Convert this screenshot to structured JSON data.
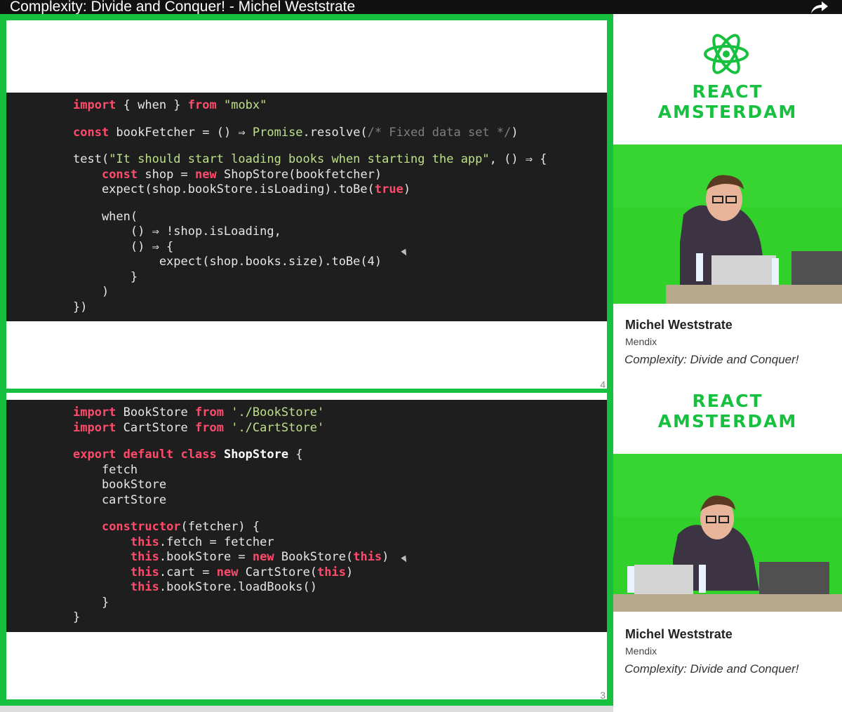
{
  "window": {
    "title": "Complexity: Divide and Conquer! - Michel Weststrate",
    "share_icon": "share-arrow-icon"
  },
  "slide1": {
    "page_number": "4",
    "code": [
      [
        [
          "kw",
          "import"
        ],
        [
          "p",
          " { when } "
        ],
        [
          "kw",
          "from"
        ],
        [
          "str",
          " \"mobx\""
        ]
      ],
      [],
      [
        [
          "kw",
          "const"
        ],
        [
          "p",
          " bookFetcher = () ⇒ "
        ],
        [
          "str",
          "Promise"
        ],
        [
          "p",
          ".resolve("
        ],
        [
          "cm",
          "/* Fixed data set */"
        ],
        [
          "p",
          ")"
        ]
      ],
      [],
      [
        [
          "p",
          "test("
        ],
        [
          "str",
          "\"It should start loading books when starting the app\""
        ],
        [
          "p",
          ", () ⇒ {"
        ]
      ],
      [
        [
          "p",
          "    "
        ],
        [
          "kw",
          "const"
        ],
        [
          "p",
          " shop = "
        ],
        [
          "kw",
          "new"
        ],
        [
          "p",
          " ShopStore(bookfetcher)"
        ]
      ],
      [
        [
          "p",
          "    expect(shop.bookStore.isLoading).toBe("
        ],
        [
          "kw",
          "true"
        ],
        [
          "p",
          ")"
        ]
      ],
      [],
      [
        [
          "p",
          "    when("
        ]
      ],
      [
        [
          "p",
          "        () ⇒ !shop.isLoading,"
        ]
      ],
      [
        [
          "p",
          "        () ⇒ {"
        ]
      ],
      [
        [
          "p",
          "            expect(shop.books.size).toBe(4)"
        ]
      ],
      [
        [
          "p",
          "        }"
        ]
      ],
      [
        [
          "p",
          "    )"
        ]
      ],
      [
        [
          "p",
          "})"
        ]
      ]
    ]
  },
  "slide2": {
    "page_number": "3",
    "code": [
      [
        [
          "kw",
          "import"
        ],
        [
          "p",
          " BookStore "
        ],
        [
          "kw",
          "from"
        ],
        [
          "str",
          " './BookStore'"
        ]
      ],
      [
        [
          "kw",
          "import"
        ],
        [
          "p",
          " CartStore "
        ],
        [
          "kw",
          "from"
        ],
        [
          "str",
          " './CartStore'"
        ]
      ],
      [],
      [
        [
          "kw",
          "export default class"
        ],
        [
          "p",
          " "
        ],
        [
          "cls",
          "ShopStore"
        ],
        [
          "p",
          " {"
        ]
      ],
      [
        [
          "p",
          "    fetch"
        ]
      ],
      [
        [
          "p",
          "    bookStore"
        ]
      ],
      [
        [
          "p",
          "    cartStore"
        ]
      ],
      [],
      [
        [
          "p",
          "    "
        ],
        [
          "kw",
          "constructor"
        ],
        [
          "p",
          "(fetcher) {"
        ]
      ],
      [
        [
          "p",
          "        "
        ],
        [
          "kw",
          "this"
        ],
        [
          "p",
          ".fetch = fetcher"
        ]
      ],
      [
        [
          "p",
          "        "
        ],
        [
          "kw",
          "this"
        ],
        [
          "p",
          ".bookStore = "
        ],
        [
          "kw",
          "new"
        ],
        [
          "p",
          " BookStore("
        ],
        [
          "kw",
          "this"
        ],
        [
          "p",
          ")"
        ]
      ],
      [
        [
          "p",
          "        "
        ],
        [
          "kw",
          "this"
        ],
        [
          "p",
          ".cart = "
        ],
        [
          "kw",
          "new"
        ],
        [
          "p",
          " CartStore("
        ],
        [
          "kw",
          "this"
        ],
        [
          "p",
          ")"
        ]
      ],
      [
        [
          "p",
          "        "
        ],
        [
          "kw",
          "this"
        ],
        [
          "p",
          ".bookStore.loadBooks()"
        ]
      ],
      [
        [
          "p",
          "    }"
        ]
      ],
      [
        [
          "p",
          "}"
        ]
      ]
    ]
  },
  "sidebar": {
    "brand_line1": "REACT",
    "brand_line2": "AMSTERDAM",
    "speaker": "Michel Weststrate",
    "company": "Mendix",
    "talk_title": "Complexity: Divide and Conquer!"
  },
  "colors": {
    "accent_green": "#17c03f",
    "code_bg": "#1e1e1e",
    "keyword": "#ff4b6b",
    "string": "#bfe08a"
  }
}
